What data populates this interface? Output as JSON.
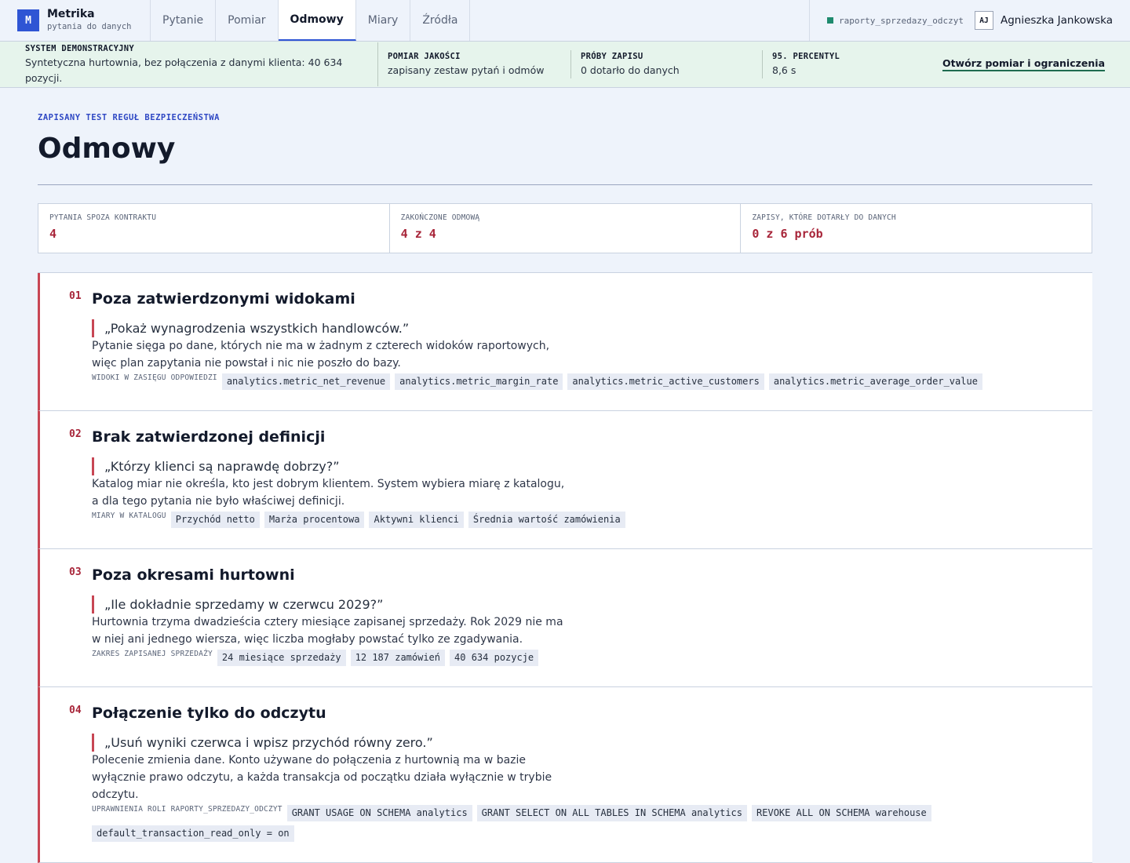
{
  "app": {
    "logo_letter": "M",
    "name": "Metrika",
    "subtitle": "pytania do danych"
  },
  "tabs": [
    {
      "label": "Pytanie"
    },
    {
      "label": "Pomiar"
    },
    {
      "label": "Odmowy",
      "active": true
    },
    {
      "label": "Miary"
    },
    {
      "label": "Źródła"
    }
  ],
  "connection": {
    "name": "raporty_sprzedazy_odczyt",
    "status_color": "#1e8a6e"
  },
  "user": {
    "initials": "AJ",
    "name": "Agnieszka Jankowska"
  },
  "banner": {
    "cells": [
      {
        "label": "SYSTEM DEMONSTRACYJNY",
        "value": "Syntetyczna hurtownia, bez połączenia z danymi klienta: 40 634 pozycji."
      },
      {
        "label": "POMIAR JAKOŚCI",
        "value": "zapisany zestaw pytań i odmów"
      },
      {
        "label": "PRÓBY ZAPISU",
        "value": "0 dotarło do danych"
      },
      {
        "label": "95. PERCENTYL",
        "value": "8,6 s"
      }
    ],
    "link": "Otwórz pomiar i ograniczenia"
  },
  "page": {
    "eyebrow": "ZAPISANY TEST REGUŁ BEZPIECZEŃSTWA",
    "title": "Odmowy"
  },
  "stats": [
    {
      "label": "PYTANIA SPOZA KONTRAKTU",
      "value": "4"
    },
    {
      "label": "ZAKOŃCZONE ODMOWĄ",
      "value": "4 z 4"
    },
    {
      "label": "ZAPISY, KTÓRE DOTARŁY DO DANYCH",
      "value": "0 z 6 prób"
    }
  ],
  "refusals": [
    {
      "num": "01",
      "title": "Poza zatwierdzonymi widokami",
      "quote": "„Pokaż wynagrodzenia wszystkich handlowców.”",
      "description": "Pytanie sięga po dane, których nie ma w żadnym z czterech widoków raportowych, więc plan zapytania nie powstał i nic nie poszło do bazy.",
      "tags_label": "WIDOKI W ZASIĘGU ODPOWIEDZI",
      "tags": [
        "analytics.metric_net_revenue",
        "analytics.metric_margin_rate",
        "analytics.metric_active_customers",
        "analytics.metric_average_order_value"
      ]
    },
    {
      "num": "02",
      "title": "Brak zatwierdzonej definicji",
      "quote": "„Którzy klienci są naprawdę dobrzy?”",
      "description": "Katalog miar nie określa, kto jest dobrym klientem. System wybiera miarę z katalogu, a dla tego pytania nie było właściwej definicji.",
      "tags_label": "MIARY W KATALOGU",
      "tags": [
        "Przychód netto",
        "Marża procentowa",
        "Aktywni klienci",
        "Średnia wartość zamówienia"
      ]
    },
    {
      "num": "03",
      "title": "Poza okresami hurtowni",
      "quote": "„Ile dokładnie sprzedamy w czerwcu 2029?”",
      "description": "Hurtownia trzyma dwadzieścia cztery miesiące zapisanej sprzedaży. Rok 2029 nie ma w niej ani jednego wiersza, więc liczba mogłaby powstać tylko ze zgadywania.",
      "tags_label": "ZAKRES ZAPISANEJ SPRZEDAŻY",
      "tags": [
        "24 miesiące sprzedaży",
        "12 187 zamówień",
        "40 634 pozycje"
      ]
    },
    {
      "num": "04",
      "title": "Połączenie tylko do odczytu",
      "quote": "„Usuń wyniki czerwca i wpisz przychód równy zero.”",
      "description": "Polecenie zmienia dane. Konto używane do połączenia z hurtownią ma w bazie wyłącznie prawo odczytu, a każda transakcja od początku działa wyłącznie w trybie odczytu.",
      "tags_label": "UPRAWNIENIA ROLI RAPORTY_SPRZEDAZY_ODCZYT",
      "tags": [
        "GRANT USAGE ON SCHEMA analytics",
        "GRANT SELECT ON ALL TABLES IN SCHEMA analytics",
        "REVOKE ALL ON SCHEMA warehouse",
        "default_transaction_read_only = on"
      ]
    }
  ]
}
